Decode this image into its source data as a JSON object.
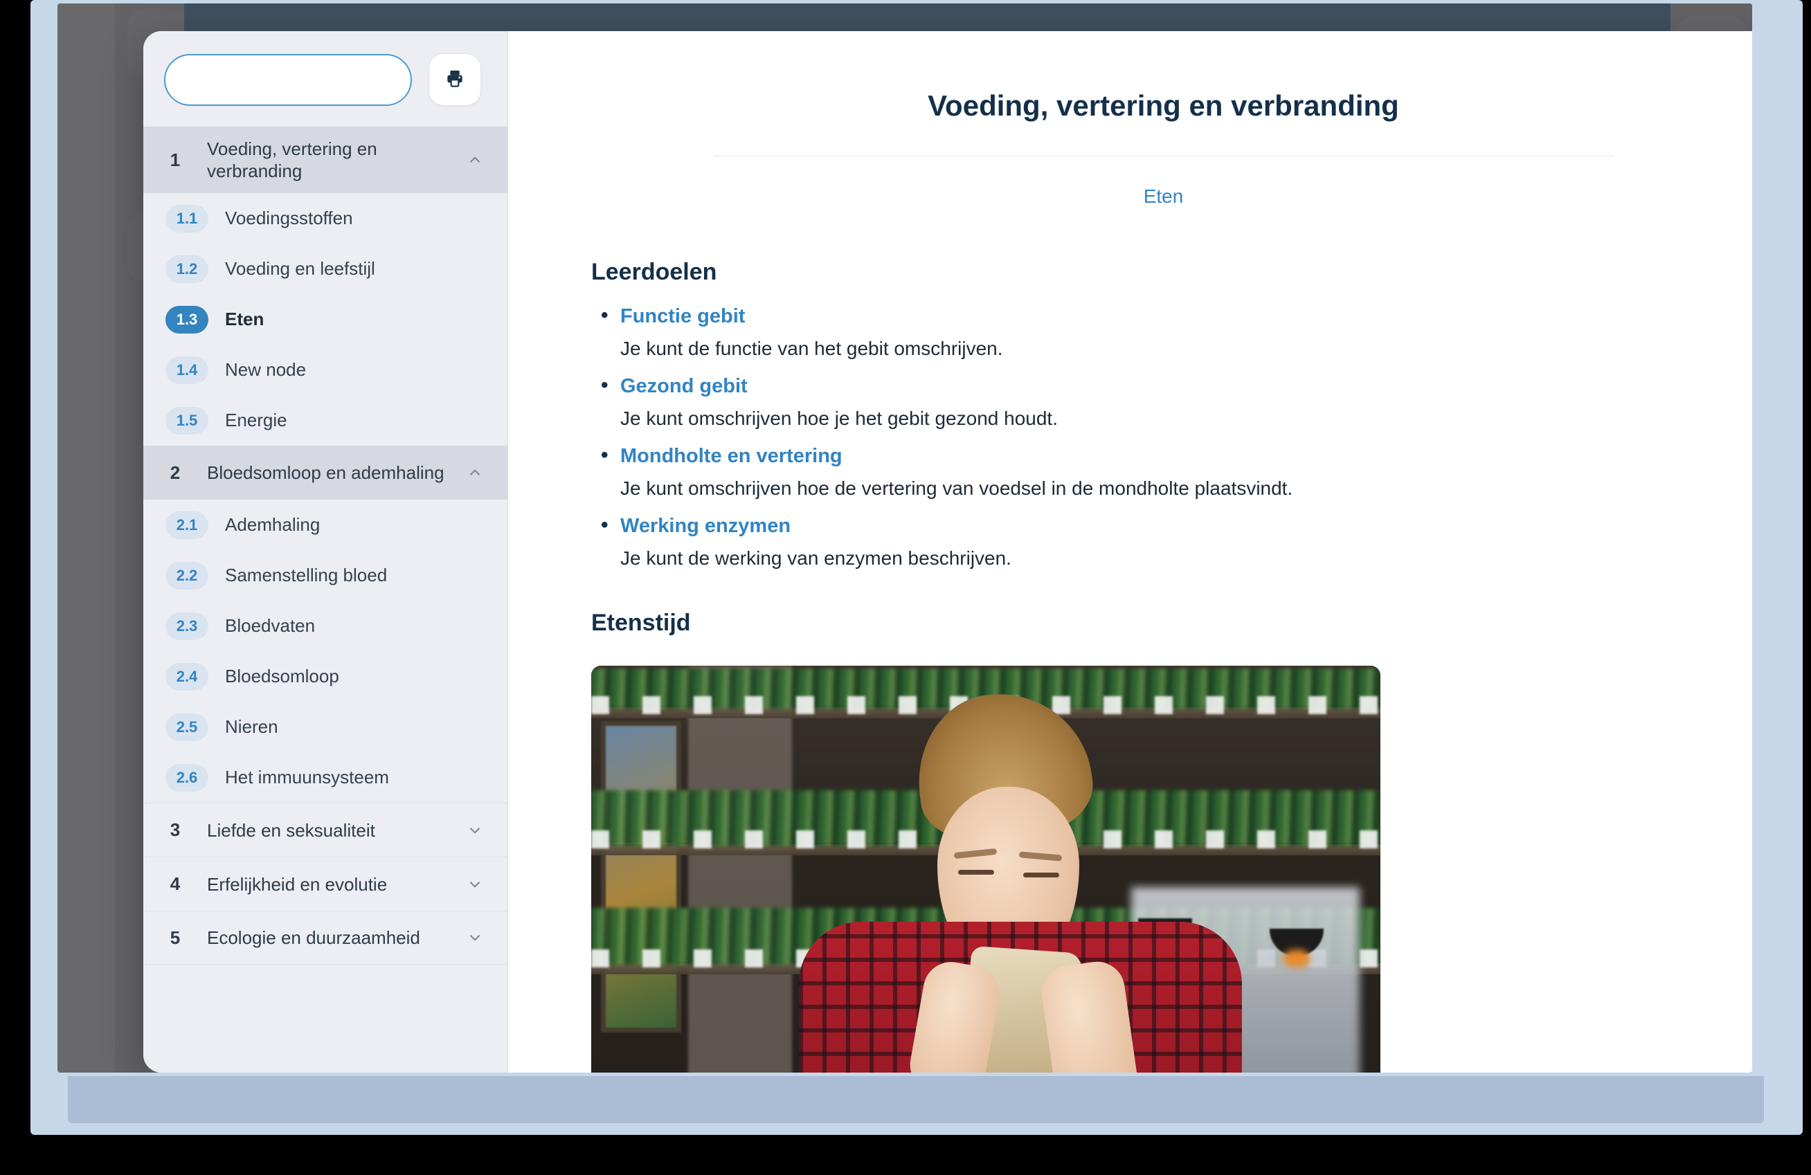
{
  "sidebar": {
    "search": {
      "value": "",
      "placeholder": ""
    },
    "search_button_icon": "search-icon",
    "print_button_icon": "print-icon",
    "chapters": [
      {
        "number": "1",
        "title": "Voeding, vertering en verbranding",
        "expanded": true,
        "chevron": "chevron-up-icon",
        "items": [
          {
            "number": "1.1",
            "label": "Voedingsstoffen",
            "active": false
          },
          {
            "number": "1.2",
            "label": "Voeding en leefstijl",
            "active": false
          },
          {
            "number": "1.3",
            "label": "Eten",
            "active": true
          },
          {
            "number": "1.4",
            "label": "New node",
            "active": false
          },
          {
            "number": "1.5",
            "label": "Energie",
            "active": false
          }
        ]
      },
      {
        "number": "2",
        "title": "Bloedsomloop en ademhaling",
        "expanded": true,
        "chevron": "chevron-up-icon",
        "items": [
          {
            "number": "2.1",
            "label": "Ademhaling",
            "active": false
          },
          {
            "number": "2.2",
            "label": "Samenstelling bloed",
            "active": false
          },
          {
            "number": "2.3",
            "label": "Bloedvaten",
            "active": false
          },
          {
            "number": "2.4",
            "label": "Bloedsomloop",
            "active": false
          },
          {
            "number": "2.5",
            "label": "Nieren",
            "active": false
          },
          {
            "number": "2.6",
            "label": "Het immuunsysteem",
            "active": false
          }
        ]
      },
      {
        "number": "3",
        "title": "Liefde en seksualiteit",
        "expanded": false,
        "chevron": "chevron-down-icon",
        "items": []
      },
      {
        "number": "4",
        "title": "Erfelijkheid en evolutie",
        "expanded": false,
        "chevron": "chevron-down-icon",
        "items": []
      },
      {
        "number": "5",
        "title": "Ecologie en duurzaamheid",
        "expanded": false,
        "chevron": "chevron-down-icon",
        "items": []
      }
    ]
  },
  "content": {
    "close_icon": "close-icon",
    "title": "Voeding, vertering en verbranding",
    "subtitle": "Eten",
    "learning_goals_heading": "Leerdoelen",
    "goals": [
      {
        "title": "Functie gebit",
        "description": "Je kunt de functie van het gebit omschrijven."
      },
      {
        "title": "Gezond gebit",
        "description": "Je kunt omschrijven hoe je het gebit gezond houdt."
      },
      {
        "title": "Mondholte en vertering",
        "description": "Je kunt omschrijven hoe de vertering van voedsel in de mondholte plaatsvindt."
      },
      {
        "title": "Werking enzymen",
        "description": "Je kunt de werking van enzymen beschrijven."
      }
    ],
    "mealtime_heading": "Etenstijd",
    "photo_alt": "photo-boy-eating-sandwich-in-cafe"
  },
  "background": {
    "left_rail_icons": [
      "users-icon",
      "home-icon",
      "book-icon",
      "copy-icon",
      "share-icon",
      "list-icon",
      "lock-icon",
      "chart-icon",
      "menu-icon"
    ],
    "right_rail_icons": [
      "clipboard-icon",
      "active-tool-icon",
      "tool-icon",
      "tool-icon",
      "tool-icon",
      "tool-icon"
    ]
  },
  "colors": {
    "accent_blue": "#3184c4",
    "dark_navy": "#1b3247",
    "title_navy": "#14304a",
    "sidebar_bg": "#edeef3",
    "chapter_bg": "#d7d9e1",
    "badge_bg": "#dae4f0",
    "topbar": "#1d4662",
    "frame_blue": "#c6d7ea"
  }
}
